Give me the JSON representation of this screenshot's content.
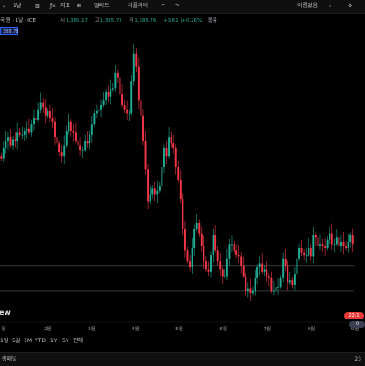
{
  "toolbar": {
    "items": [
      {
        "name": "chevron-down-icon",
        "label": "⌄"
      },
      {
        "name": "interval-button",
        "label": "1날"
      },
      {
        "name": "chart-type-icon",
        "label": "▥"
      },
      {
        "name": "indicators-icon",
        "label": "ƒx"
      },
      {
        "name": "indicators-label",
        "label": "지표"
      },
      {
        "name": "layout-icon",
        "label": "⊞"
      },
      {
        "name": "alert-label",
        "label": "얼러트"
      },
      {
        "name": "replay-label",
        "label": "리플레이"
      },
      {
        "name": "undo-icon",
        "label": "↶"
      },
      {
        "name": "redo-icon",
        "label": "↷"
      },
      {
        "name": "unnamed-label",
        "label": "이름없음"
      },
      {
        "name": "search-icon",
        "label": "⌕"
      },
      {
        "name": "settings-icon",
        "label": "⚙"
      }
    ]
  },
  "legend": {
    "symbol": "국 원 · 1날 · ICE",
    "open_label": "시",
    "open": "1,385.17",
    "high_label": "고",
    "high": "1,385.72",
    "low_label": "저",
    "low": "1,385.76",
    "change": "+3.61 (+0.26%)",
    "volume": "볼륨"
  },
  "price_badge": "388.78",
  "watermark": "ew",
  "flag_label": "22:1",
  "flag2_label": "0",
  "ranges": [
    "1일",
    "5일",
    "1M",
    "YTD",
    "1Y",
    "5Y",
    "전체"
  ],
  "status": {
    "left": "링패널",
    "right": "23"
  },
  "colors": {
    "up": "#22ab94",
    "down": "#f23645",
    "bg": "#000000",
    "grid": "#1c1c1c",
    "hline": "#5a5a5a"
  },
  "chart_data": {
    "type": "candlestick",
    "x_tick_labels": [
      "월",
      "2월",
      "3월",
      "4월",
      "5월",
      "6월",
      "7월",
      "8월",
      "9월"
    ],
    "grid": false,
    "series": [
      {
        "values": [
          1425,
          1430,
          1433,
          1435,
          1431,
          1434,
          1433,
          1437,
          1436,
          1436,
          1438,
          1439,
          1437,
          1441,
          1444,
          1443,
          1448,
          1451,
          1449,
          1445,
          1447,
          1444,
          1442,
          1435,
          1432,
          1428,
          1426,
          1431,
          1438,
          1442,
          1438,
          1437,
          1433,
          1431,
          1429,
          1429,
          1433,
          1432,
          1436,
          1441,
          1446,
          1447,
          1448,
          1450,
          1452,
          1456,
          1454,
          1457,
          1458,
          1465,
          1463,
          1455,
          1450,
          1448,
          1446,
          1446,
          1461,
          1474,
          1468,
          1452,
          1445,
          1433,
          1420,
          1405,
          1408,
          1411,
          1408,
          1410,
          1412,
          1421,
          1430,
          1426,
          1435,
          1432,
          1430,
          1421,
          1415,
          1406,
          1392,
          1382,
          1377,
          1374,
          1383,
          1392,
          1395,
          1390,
          1384,
          1377,
          1373,
          1372,
          1380,
          1389,
          1382,
          1377,
          1373,
          1370,
          1370,
          1378,
          1385,
          1385,
          1382,
          1380,
          1379,
          1375,
          1370,
          1363,
          1364,
          1362,
          1363,
          1369,
          1374,
          1376,
          1372,
          1373,
          1370,
          1369,
          1363,
          1363,
          1365,
          1365,
          1369,
          1378,
          1375,
          1367,
          1368,
          1366,
          1371,
          1378,
          1383,
          1381,
          1380,
          1380,
          1383,
          1379,
          1389,
          1388,
          1384,
          1385,
          1384,
          1383,
          1387,
          1390,
          1385,
          1385,
          1388,
          1384,
          1386,
          1384,
          1383,
          1386,
          1389,
          1385
        ]
      }
    ],
    "hlines": [
      1375,
      1363
    ]
  }
}
